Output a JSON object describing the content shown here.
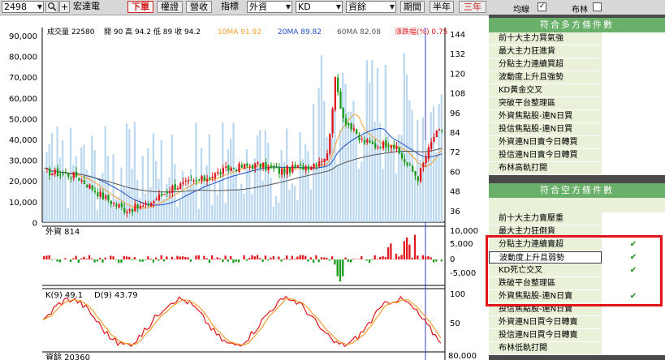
{
  "toolbar": {
    "stock_code": "2498",
    "stock_name": "宏達電",
    "btn_xiadan": "下單",
    "btn_quanzheng": "權證",
    "btn_yingshou": "營收",
    "indicator_label": "指標",
    "indicator_value": "外資",
    "indicator2_value": "KD",
    "indicator3_value": "資餘",
    "period_label": "期間",
    "period_half": "半年",
    "period_3y": "三年",
    "plus": "+"
  },
  "panel": {
    "ma_label": "均線",
    "ma_checked": "✓",
    "boll_label": "布林",
    "bull": {
      "title": "符合多方條件數",
      "rows": [
        {
          "label": "前十大主力買氣強",
          "check": ""
        },
        {
          "label": "最大主力狂進貨",
          "check": ""
        },
        {
          "label": "分點主力連續買超",
          "check": ""
        },
        {
          "label": "波動度上升且強勢",
          "check": ""
        },
        {
          "label": "KD黃金交叉",
          "check": ""
        },
        {
          "label": "突破平台整理區",
          "check": ""
        },
        {
          "label": "外資焦點股-連N日買",
          "check": ""
        },
        {
          "label": "投信焦點股-連N日買",
          "check": ""
        },
        {
          "label": "外資連N日賣今日轉買",
          "check": ""
        },
        {
          "label": "投信連N日賣今日轉買",
          "check": ""
        },
        {
          "label": "布林高軌打開",
          "check": ""
        }
      ]
    },
    "bear": {
      "title": "符合空方條件數",
      "rows": [
        {
          "label": "前十大主力賣壓重",
          "check": ""
        },
        {
          "label": "最大主力狂倒貨",
          "check": ""
        },
        {
          "label": "分點主力連續賣超",
          "check": "✔"
        },
        {
          "label": "波動度上升且弱勢",
          "check": "✔"
        },
        {
          "label": "KD死亡交叉",
          "check": "✔"
        },
        {
          "label": "跌破平台整理區",
          "check": ""
        },
        {
          "label": "外資焦點股-連N日賣",
          "check": "✔"
        },
        {
          "label": "投信焦點股-連N日賣",
          "check": ""
        },
        {
          "label": "外資連N日買今日轉賣",
          "check": ""
        },
        {
          "label": "投信連N日買今日轉賣",
          "check": ""
        },
        {
          "label": "布林低軌打開",
          "check": ""
        }
      ]
    }
  },
  "chart": {
    "info": {
      "volume": "成交量 22580",
      "ohlc": "開 90  高 94.2  低 89  收 94.2",
      "ma10": "10MA 91.92",
      "ma20": "20MA 89.82",
      "ma60": "60MA 82.08",
      "change": "漲跌幅(%) 0.75"
    },
    "volume_ticks": [
      "90,000",
      "80,000",
      "70,000",
      "60,000",
      "50,000",
      "40,000",
      "30,000",
      "20,000",
      "10,000",
      "0"
    ],
    "price_ticks": [
      "144",
      "132",
      "120",
      "108",
      "96",
      "84",
      "72",
      "60",
      "48",
      "36"
    ],
    "foreign_label": "外資 814",
    "foreign_ticks": [
      "10,000",
      "5,000",
      "0",
      "-5,000"
    ],
    "kd_k": "K(9) 49.1",
    "kd_d": "D(9) 43.79",
    "kd_ticks": [
      "100",
      "50"
    ],
    "margin_label": "資餘 20360",
    "margin_tick": "80,000",
    "colors": {
      "up": "#e0161a",
      "down": "#1a9a1a",
      "ma10": "#f0a030",
      "ma20": "#2050c0",
      "ma60": "#555555",
      "volume": "#bcd8ef"
    }
  }
}
